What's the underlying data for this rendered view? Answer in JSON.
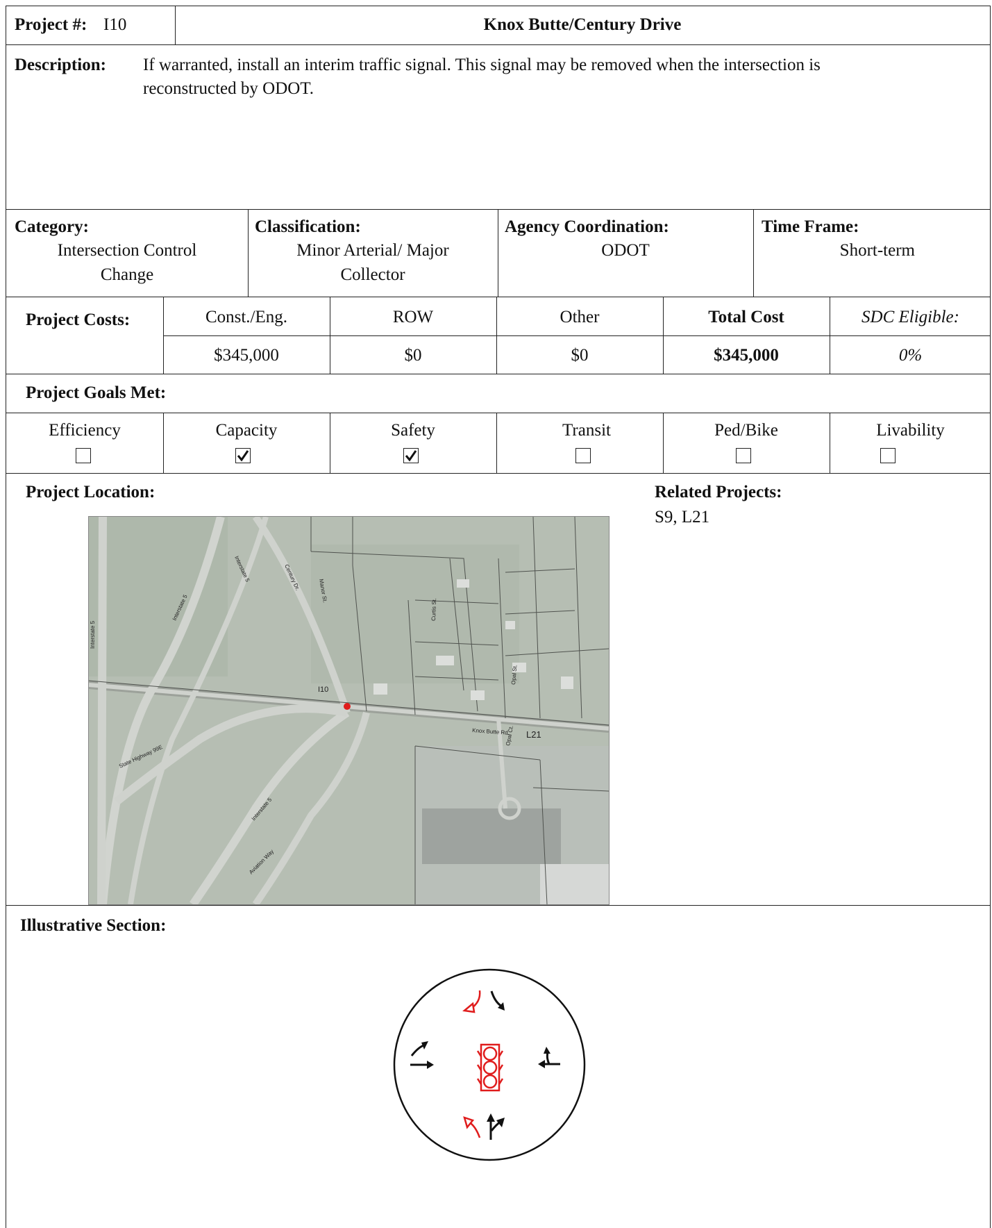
{
  "header": {
    "project_label": "Project #:",
    "project_number": "I10",
    "title": "Knox Butte/Century Drive"
  },
  "description": {
    "label": "Description:",
    "text_line1": "If warranted, install an interim traffic signal. This signal may be removed when the intersection is",
    "text_line2": "reconstructed by ODOT."
  },
  "info": {
    "category_label": "Category:",
    "category_line1": "Intersection Control",
    "category_line2": "Change",
    "classification_label": "Classification:",
    "classification_line1": "Minor Arterial/ Major",
    "classification_line2": "Collector",
    "agency_label": "Agency Coordination:",
    "agency_value": "ODOT",
    "timeframe_label": "Time Frame:",
    "timeframe_value": "Short-term"
  },
  "costs": {
    "label": "Project Costs:",
    "headers": [
      "Const./Eng.",
      "ROW",
      "Other",
      "Total Cost",
      "SDC Eligible:"
    ],
    "values": [
      "$345,000",
      "$0",
      "$0",
      "$345,000",
      "0%"
    ]
  },
  "goals": {
    "label": "Project Goals Met:",
    "items": [
      {
        "name": "Efficiency",
        "checked": false
      },
      {
        "name": "Capacity",
        "checked": true
      },
      {
        "name": "Safety",
        "checked": true
      },
      {
        "name": "Transit",
        "checked": false
      },
      {
        "name": "Ped/Bike",
        "checked": false
      },
      {
        "name": "Livability",
        "checked": false
      }
    ]
  },
  "location": {
    "label": "Project Location:",
    "related_label": "Related Projects:",
    "related_value": "S9, L21",
    "map_labels": {
      "project_marker": "I10",
      "l21": "L21",
      "knox_butte": "Knox Butte Rd.",
      "century": "Century Dr.",
      "manor": "Manor St.",
      "curtis": "Curtis St.",
      "opal_st": "Opal St.",
      "opal_ct": "Opal Ct.",
      "interstate5_a": "Interstate 5",
      "interstate5_b": "Interstate 5",
      "interstate5_c": "Interstate 5",
      "interstate5_d": "Interstate 5",
      "state_hwy": "State Highway 99E",
      "aviation": "Aviation Way"
    },
    "marker_color": "#e01c1c"
  },
  "section": {
    "label": "Illustrative Section:",
    "signal_color": "#e01c1c"
  }
}
